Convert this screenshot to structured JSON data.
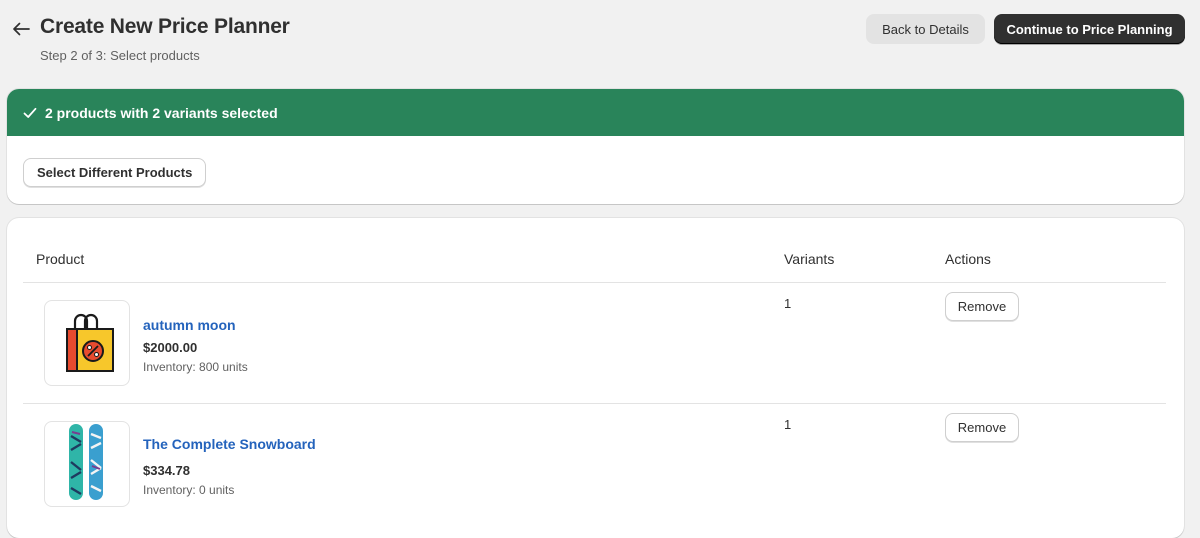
{
  "header": {
    "title": "Create New Price Planner",
    "subtitle": "Step 2 of 3: Select products",
    "back_icon": "arrow-left-icon",
    "back_button_label": "Back to Details",
    "continue_button_label": "Continue to Price Planning"
  },
  "selection": {
    "banner_text": "2 products with 2 variants selected",
    "banner_icon": "checkmark-icon",
    "banner_color": "#29845a",
    "change_button_label": "Select Different Products"
  },
  "table": {
    "columns": [
      "Product",
      "Variants",
      "Actions"
    ],
    "rows": [
      {
        "name": "autumn moon",
        "price": "$2000.00",
        "inventory": "Inventory: 800 units",
        "variants": "1",
        "action_label": "Remove",
        "thumbnail_icon": "shopping-bag-discount-icon"
      },
      {
        "name": "The Complete Snowboard",
        "price": "$334.78",
        "inventory": "Inventory: 0 units",
        "variants": "1",
        "action_label": "Remove",
        "thumbnail_icon": "snowboard-icon"
      }
    ]
  },
  "colors": {
    "link": "#2463bc",
    "primary_button": "#303030",
    "success": "#29845a"
  }
}
